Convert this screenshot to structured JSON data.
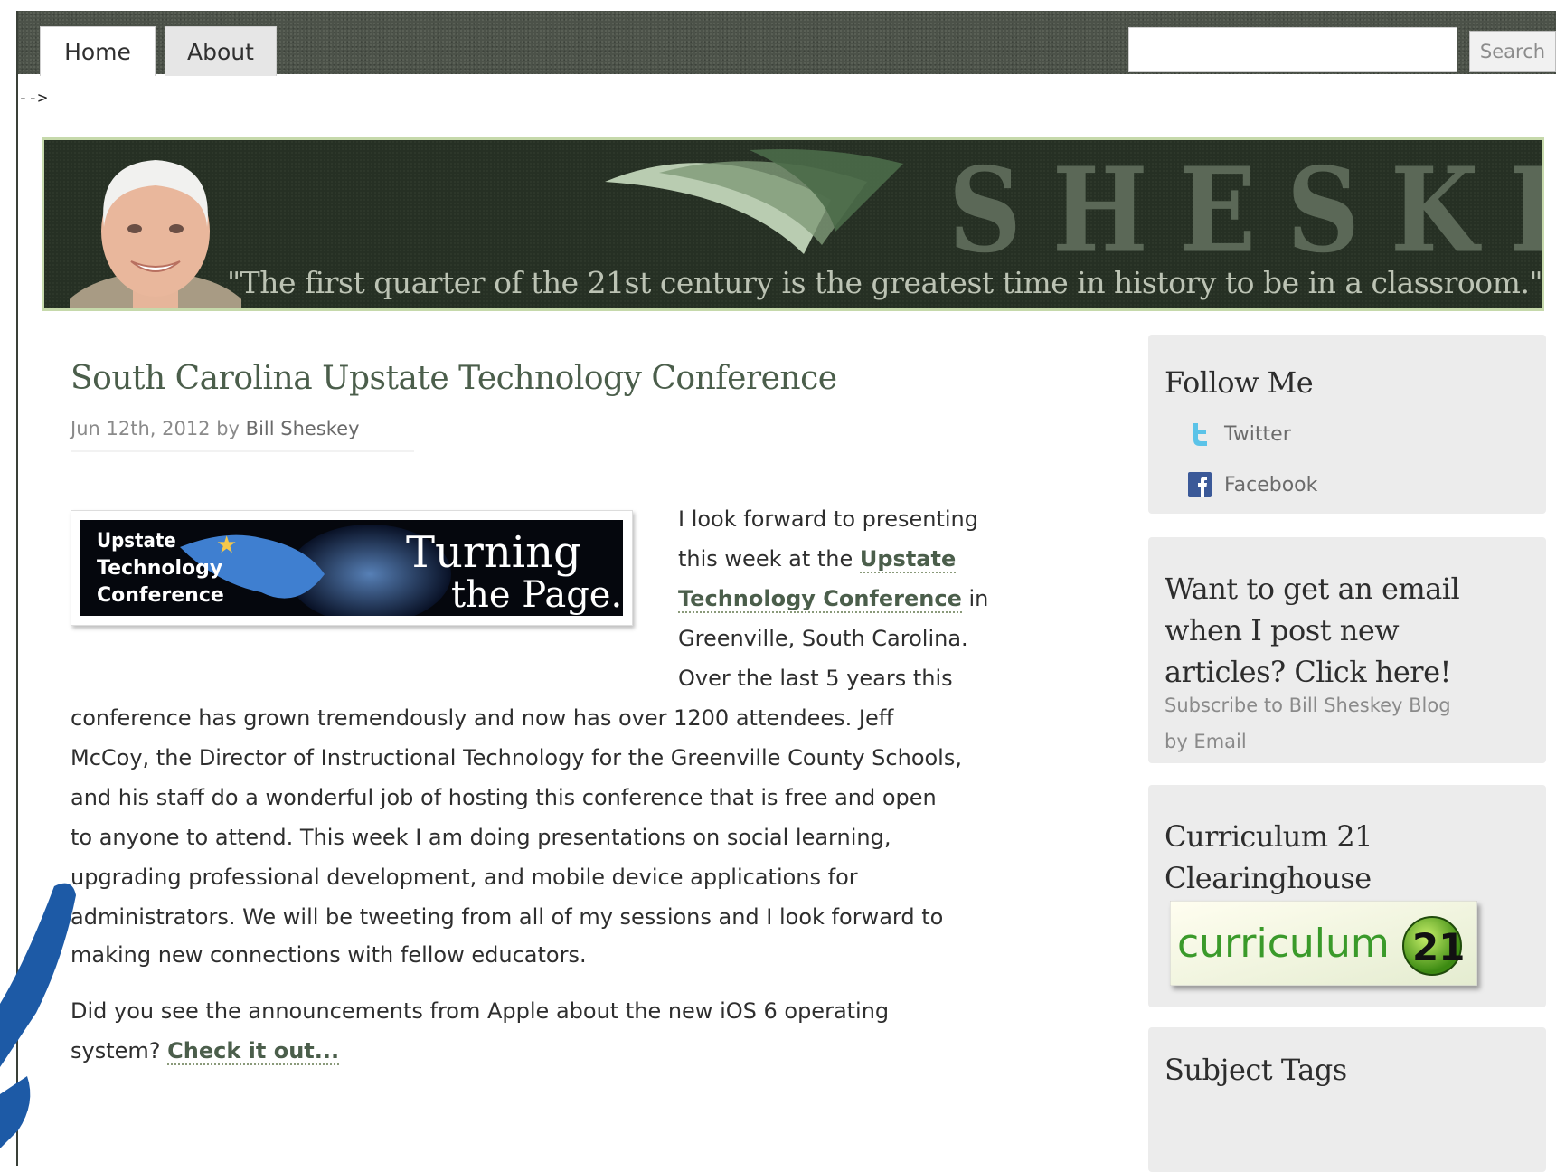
{
  "nav": {
    "tabs": [
      {
        "label": "Home"
      },
      {
        "label": "About"
      }
    ],
    "search": {
      "placeholder": "",
      "button_label": "Search"
    }
  },
  "stray_comment": "-->",
  "banner": {
    "brand_name": "SHESKEY",
    "quote": "\"The first quarter of the 21st century is the greatest time in history to be in a classroom.\""
  },
  "post": {
    "title": "South Carolina Upstate Technology Conference",
    "date": "Jun 12th, 2012 by ",
    "author": "Bill Sheskey",
    "image": {
      "left_text": [
        "Upstate",
        "Technology",
        "Conference"
      ],
      "right_text": [
        "Turning",
        "the Page..."
      ]
    },
    "paragraph1": {
      "line1": "I look forward to presenting",
      "line2_pre": "this week at the ",
      "link1": "Upstate",
      "link2": "Technology Conference",
      "line3_post": " in",
      "line4": "Greenville, South Carolina.",
      "line5": "Over the last 5 years this",
      "line6": "conference has grown tremendously and now has over 1200 attendees. Jeff",
      "line7": "McCoy, the Director of Instructional Technology for the Greenville County Schools,",
      "line8": " and his staff do a wonderful job of hosting this conference that is free and open",
      "line9": "to anyone to attend. This week I am doing presentations on social learning,",
      "line10": "upgrading professional development, and mobile device applications for",
      "line11": "administrators. We will be tweeting from all of my sessions and I look forward to",
      "line12": "making new connections with fellow educators."
    },
    "paragraph2": {
      "line1": "Did you see the announcements from Apple about the new iOS 6 operating",
      "line2_pre": "system? ",
      "link": "Check it out..."
    }
  },
  "sidebar": {
    "follow": {
      "title": "Follow Me",
      "items": [
        {
          "label": "Twitter",
          "icon": "twitter-icon"
        },
        {
          "label": "Facebook",
          "icon": "facebook-icon"
        }
      ]
    },
    "email": {
      "title_lines": [
        "Want to get an email",
        "when I post new",
        "articles? Click here!"
      ],
      "subscribe_lines": [
        "Subscribe to Bill Sheskey Blog",
        "by Email"
      ]
    },
    "c21": {
      "title_lines": [
        "Curriculum 21",
        "Clearinghouse"
      ],
      "logo_text": "curriculum",
      "logo_badge": "21"
    },
    "subject": {
      "title": "Subject Tags"
    }
  },
  "colors": {
    "nav_bg": "#4c5249",
    "banner_bg": "#263024",
    "accent_green": "#4b5e4b",
    "widget_bg": "#ececec"
  }
}
